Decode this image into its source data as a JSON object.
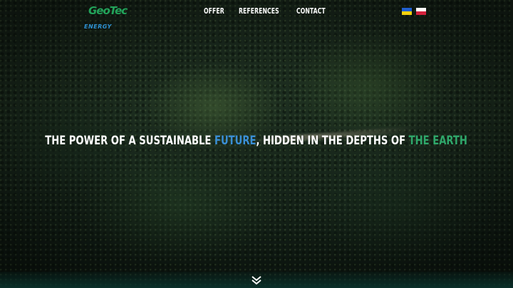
{
  "logo": {
    "line1": "GeoTec",
    "line2": "ENERGY"
  },
  "nav": {
    "items": [
      "OFFER",
      "REFERENCES",
      "CONTACT"
    ]
  },
  "languages": [
    "ukrainian-flag",
    "polish-flag"
  ],
  "hero": {
    "part1": "THE POWER OF A SUSTAINABLE ",
    "highlight1": "FUTURE",
    "part2": ", HIDDEN IN THE DEPTHS OF ",
    "highlight2": "THE EARTH"
  },
  "colors": {
    "accent_blue": "#3a8fd6",
    "accent_green": "#2fa86b"
  },
  "scroll_icon": "double-chevron-down-icon"
}
